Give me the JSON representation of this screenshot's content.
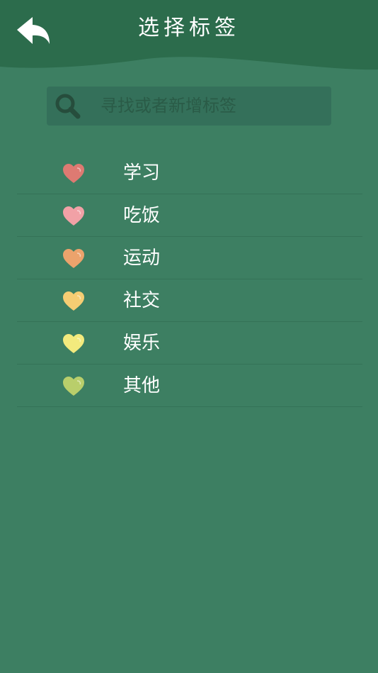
{
  "header": {
    "title": "选择标签",
    "back_icon": "back-arrow-icon",
    "bg_color": "#2c6c4c"
  },
  "search": {
    "icon": "search-icon",
    "placeholder": "寻找或者新增标签",
    "value": ""
  },
  "tags": [
    {
      "label": "学习",
      "color": "#de7a72",
      "icon": "heart-icon"
    },
    {
      "label": "吃饭",
      "color": "#f1a1a6",
      "icon": "heart-icon"
    },
    {
      "label": "运动",
      "color": "#eca36c",
      "icon": "heart-icon"
    },
    {
      "label": "社交",
      "color": "#f6cd73",
      "icon": "heart-icon"
    },
    {
      "label": "娱乐",
      "color": "#f3ea7d",
      "icon": "heart-icon"
    },
    {
      "label": "其他",
      "color": "#b9ce6b",
      "icon": "heart-icon"
    }
  ],
  "theme": {
    "background": "#3d7f62",
    "divider": "#347257"
  }
}
